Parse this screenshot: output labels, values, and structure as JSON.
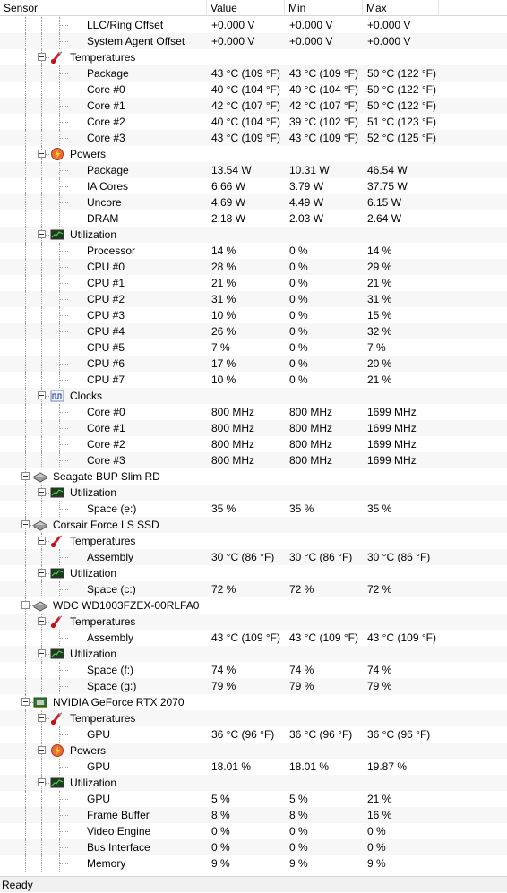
{
  "header": {
    "sensor": "Sensor",
    "value": "Value",
    "min": "Min",
    "max": "Max"
  },
  "rows": [
    {
      "level": 2,
      "label": "LLC/Ring Offset",
      "value": "+0.000 V",
      "min": "+0.000 V",
      "max": "+0.000 V"
    },
    {
      "level": 2,
      "label": "System Agent Offset",
      "value": "+0.000 V",
      "min": "+0.000 V",
      "max": "+0.000 V"
    },
    {
      "level": 1,
      "label": "Temperatures",
      "icon": "thermometer-icon",
      "group": true
    },
    {
      "level": 2,
      "label": "Package",
      "value": "43 °C  (109 °F)",
      "min": "43 °C  (109 °F)",
      "max": "50 °C  (122 °F)"
    },
    {
      "level": 2,
      "label": "Core #0",
      "value": "40 °C  (104 °F)",
      "min": "40 °C  (104 °F)",
      "max": "50 °C  (122 °F)"
    },
    {
      "level": 2,
      "label": "Core #1",
      "value": "42 °C  (107 °F)",
      "min": "42 °C  (107 °F)",
      "max": "50 °C  (122 °F)"
    },
    {
      "level": 2,
      "label": "Core #2",
      "value": "40 °C  (104 °F)",
      "min": "39 °C  (102 °F)",
      "max": "51 °C  (123 °F)"
    },
    {
      "level": 2,
      "label": "Core #3",
      "value": "43 °C  (109 °F)",
      "min": "43 °C  (109 °F)",
      "max": "52 °C  (125 °F)"
    },
    {
      "level": 1,
      "label": "Powers",
      "icon": "power-icon",
      "group": true
    },
    {
      "level": 2,
      "label": "Package",
      "value": "13.54 W",
      "min": "10.31 W",
      "max": "46.54 W"
    },
    {
      "level": 2,
      "label": "IA Cores",
      "value": "6.66 W",
      "min": "3.79 W",
      "max": "37.75 W"
    },
    {
      "level": 2,
      "label": "Uncore",
      "value": "4.69 W",
      "min": "4.49 W",
      "max": "6.15 W"
    },
    {
      "level": 2,
      "label": "DRAM",
      "value": "2.18 W",
      "min": "2.03 W",
      "max": "2.64 W"
    },
    {
      "level": 1,
      "label": "Utilization",
      "icon": "utilization-icon",
      "group": true
    },
    {
      "level": 2,
      "label": "Processor",
      "value": "14 %",
      "min": "0 %",
      "max": "14 %"
    },
    {
      "level": 2,
      "label": "CPU #0",
      "value": "28 %",
      "min": "0 %",
      "max": "29 %"
    },
    {
      "level": 2,
      "label": "CPU #1",
      "value": "21 %",
      "min": "0 %",
      "max": "21 %"
    },
    {
      "level": 2,
      "label": "CPU #2",
      "value": "31 %",
      "min": "0 %",
      "max": "31 %"
    },
    {
      "level": 2,
      "label": "CPU #3",
      "value": "10 %",
      "min": "0 %",
      "max": "15 %"
    },
    {
      "level": 2,
      "label": "CPU #4",
      "value": "26 %",
      "min": "0 %",
      "max": "32 %"
    },
    {
      "level": 2,
      "label": "CPU #5",
      "value": "7 %",
      "min": "0 %",
      "max": "7 %"
    },
    {
      "level": 2,
      "label": "CPU #6",
      "value": "17 %",
      "min": "0 %",
      "max": "20 %"
    },
    {
      "level": 2,
      "label": "CPU #7",
      "value": "10 %",
      "min": "0 %",
      "max": "21 %"
    },
    {
      "level": 1,
      "label": "Clocks",
      "icon": "clock-wave-icon",
      "group": true
    },
    {
      "level": 2,
      "label": "Core #0",
      "value": "800 MHz",
      "min": "800 MHz",
      "max": "1699 MHz"
    },
    {
      "level": 2,
      "label": "Core #1",
      "value": "800 MHz",
      "min": "800 MHz",
      "max": "1699 MHz"
    },
    {
      "level": 2,
      "label": "Core #2",
      "value": "800 MHz",
      "min": "800 MHz",
      "max": "1699 MHz"
    },
    {
      "level": 2,
      "label": "Core #3",
      "value": "800 MHz",
      "min": "800 MHz",
      "max": "1699 MHz"
    },
    {
      "level": 0,
      "label": "Seagate BUP Slim RD",
      "icon": "drive-icon",
      "group": true
    },
    {
      "level": 1,
      "label": "Utilization",
      "icon": "utilization-icon",
      "group": true
    },
    {
      "level": 2,
      "label": "Space (e:)",
      "value": "35 %",
      "min": "35 %",
      "max": "35 %"
    },
    {
      "level": 0,
      "label": "Corsair Force LS SSD",
      "icon": "drive-icon",
      "group": true
    },
    {
      "level": 1,
      "label": "Temperatures",
      "icon": "thermometer-icon",
      "group": true
    },
    {
      "level": 2,
      "label": "Assembly",
      "value": "30 °C  (86 °F)",
      "min": "30 °C  (86 °F)",
      "max": "30 °C  (86 °F)"
    },
    {
      "level": 1,
      "label": "Utilization",
      "icon": "utilization-icon",
      "group": true
    },
    {
      "level": 2,
      "label": "Space (c:)",
      "value": "72 %",
      "min": "72 %",
      "max": "72 %"
    },
    {
      "level": 0,
      "label": "WDC WD1003FZEX-00RLFA0",
      "icon": "drive-icon",
      "group": true
    },
    {
      "level": 1,
      "label": "Temperatures",
      "icon": "thermometer-icon",
      "group": true
    },
    {
      "level": 2,
      "label": "Assembly",
      "value": "43 °C  (109 °F)",
      "min": "43 °C  (109 °F)",
      "max": "43 °C  (109 °F)"
    },
    {
      "level": 1,
      "label": "Utilization",
      "icon": "utilization-icon",
      "group": true
    },
    {
      "level": 2,
      "label": "Space (f:)",
      "value": "74 %",
      "min": "74 %",
      "max": "74 %"
    },
    {
      "level": 2,
      "label": "Space (g:)",
      "value": "79 %",
      "min": "79 %",
      "max": "79 %"
    },
    {
      "level": 0,
      "label": "NVIDIA GeForce RTX 2070",
      "icon": "gpu-icon",
      "group": true
    },
    {
      "level": 1,
      "label": "Temperatures",
      "icon": "thermometer-icon",
      "group": true
    },
    {
      "level": 2,
      "label": "GPU",
      "value": "36 °C  (96 °F)",
      "min": "36 °C  (96 °F)",
      "max": "36 °C  (96 °F)"
    },
    {
      "level": 1,
      "label": "Powers",
      "icon": "power-icon",
      "group": true
    },
    {
      "level": 2,
      "label": "GPU",
      "value": "18.01 %",
      "min": "18.01 %",
      "max": "19.87 %"
    },
    {
      "level": 1,
      "label": "Utilization",
      "icon": "utilization-icon",
      "group": true
    },
    {
      "level": 2,
      "label": "GPU",
      "value": "5 %",
      "min": "5 %",
      "max": "21 %"
    },
    {
      "level": 2,
      "label": "Frame Buffer",
      "value": "8 %",
      "min": "8 %",
      "max": "16 %"
    },
    {
      "level": 2,
      "label": "Video Engine",
      "value": "0 %",
      "min": "0 %",
      "max": "0 %"
    },
    {
      "level": 2,
      "label": "Bus Interface",
      "value": "0 %",
      "min": "0 %",
      "max": "0 %"
    },
    {
      "level": 2,
      "label": "Memory",
      "value": "9 %",
      "min": "9 %",
      "max": "9 %"
    }
  ],
  "status": {
    "text": "Ready"
  }
}
